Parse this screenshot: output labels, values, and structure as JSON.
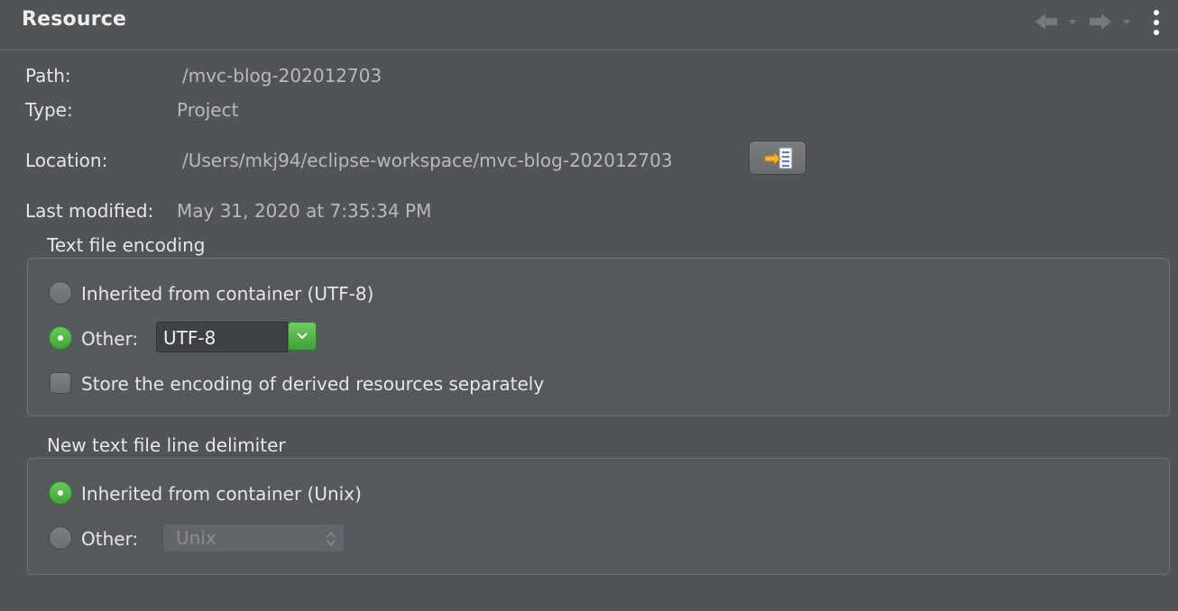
{
  "header": {
    "title": "Resource",
    "back_icon": "arrow-left-icon",
    "forward_icon": "arrow-right-icon",
    "menu_icon": "vertical-ellipsis-icon"
  },
  "info": {
    "path_label": "Path:",
    "path_value": "/mvc-blog-202012703",
    "type_label": "Type:",
    "type_value": "Project",
    "location_label": "Location:",
    "location_value": "/Users/mkj94/eclipse-workspace/mvc-blog-202012703",
    "show_in_finder_icon": "show-in-system-explorer-icon",
    "modified_label": "Last modified:",
    "modified_value": "May 31, 2020 at 7:35:34 PM"
  },
  "encoding": {
    "title": "Text file encoding",
    "inherited_label": "Inherited from container (UTF-8)",
    "inherited_selected": false,
    "other_label": "Other:",
    "other_selected": true,
    "other_value": "UTF-8",
    "derived_label": "Store the encoding of derived resources separately",
    "derived_checked": false
  },
  "delimiter": {
    "title": "New text file line delimiter",
    "inherited_label": "Inherited from container (Unix)",
    "inherited_selected": true,
    "other_label": "Other:",
    "other_selected": false,
    "other_value": "Unix"
  },
  "colors": {
    "background": "#515457",
    "accent_green": "#4cb842"
  }
}
